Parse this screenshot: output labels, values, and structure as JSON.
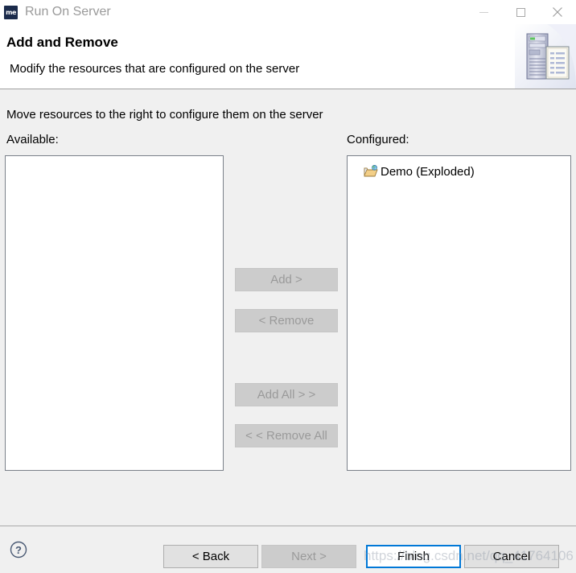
{
  "window": {
    "title": "Run On Server",
    "app_icon_label": "me",
    "controls": [
      {
        "name": "minimize",
        "glyph": "minimize-icon"
      },
      {
        "name": "maximize",
        "glyph": "maximize-icon"
      },
      {
        "name": "close",
        "glyph": "close-icon"
      }
    ]
  },
  "header": {
    "title": "Add and Remove",
    "description": "Modify the resources that are configured on the server",
    "banner_icon": "server-and-document-icon"
  },
  "main": {
    "intro": "Move resources to the right to configure them on the server",
    "available_label": "Available:",
    "configured_label": "Configured:",
    "available_items": [],
    "configured_items": [
      {
        "label": "Demo (Exploded)",
        "icon": "open-folder-web-icon"
      }
    ],
    "transfer_buttons": [
      {
        "label": "Add >",
        "name": "add-button",
        "enabled": false
      },
      {
        "label": "< Remove",
        "name": "remove-button",
        "enabled": false
      },
      {
        "label": "Add All > >",
        "name": "add-all-button",
        "enabled": false
      },
      {
        "label": "< < Remove All",
        "name": "remove-all-button",
        "enabled": false
      }
    ]
  },
  "footer": {
    "help_icon": "help-question-icon",
    "back_label": "< Back",
    "next_label": "Next >",
    "finish_label": "Finish",
    "cancel_label": "Cancel"
  },
  "watermark": {
    "text": "https://blog.csdn.net/qq_41764106"
  },
  "colors": {
    "accent": "#0078d7",
    "window_bg": "#f0f0f0",
    "header_bg": "#ffffff",
    "disabled_text": "#9a9a9a",
    "title_text": "#9a9a9a",
    "border": "#7a8089"
  }
}
